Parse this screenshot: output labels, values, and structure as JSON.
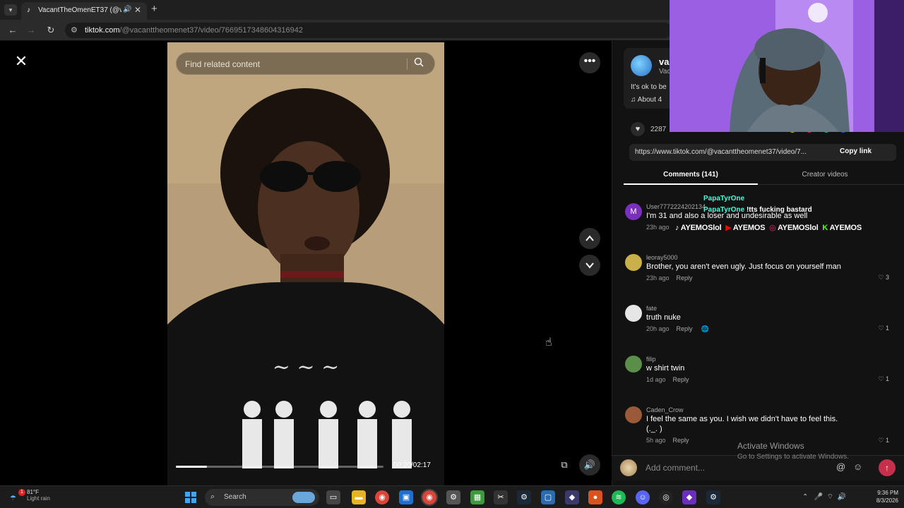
{
  "browser": {
    "tab_title": "VacantTheOmenET37 (@va",
    "url_host": "tiktok.com",
    "url_path": "/@vacanttheomenet37/video/7669517348604316942"
  },
  "video": {
    "search_placeholder": "Find related content",
    "time_readout": "00:20/02:17",
    "progress_fraction": 0.15
  },
  "author": {
    "name": "va",
    "handle": "Vac",
    "caption": "It's ok to be",
    "music": "♫  About 4"
  },
  "stats": {
    "likes": "2287"
  },
  "share": {
    "link": "https://www.tiktok.com/@vacanttheomenet37/video/7...",
    "copy_label": "Copy link"
  },
  "tabs": {
    "comments": "Comments (141)",
    "creator_videos": "Creator videos"
  },
  "comments": [
    {
      "user": "User7772224202134",
      "text": "I'm 31 and also a loser and undesirable as well",
      "time": "23h ago",
      "reply": "Reply",
      "likes": "",
      "avatar_letter": "M",
      "avatar_color": "#7b2fbf"
    },
    {
      "user": "leoray5000",
      "text": "Brother, you aren't even ugly. Just focus on yourself man",
      "time": "23h ago",
      "reply": "Reply",
      "likes": "3",
      "avatar_letter": "",
      "avatar_color": "#c9b04a"
    },
    {
      "user": "fate",
      "text": "truth nuke",
      "time": "20h ago",
      "reply": "Reply",
      "likes": "1",
      "avatar_letter": "",
      "avatar_color": "#e6e6e6"
    },
    {
      "user": "filip",
      "text": "w shirt twin",
      "time": "1d ago",
      "reply": "Reply",
      "likes": "1",
      "avatar_letter": "",
      "avatar_color": "#5a8f4a"
    },
    {
      "user": "Caden_Crow",
      "text": "I feel the same as you. I wish we didn't have to feel this.",
      "text2": "(._. )",
      "time": "5h ago",
      "reply": "Reply",
      "likes": "1",
      "avatar_letter": "",
      "avatar_color": "#9a5a3a"
    }
  ],
  "stream_overlay": {
    "line1": "PapaTyrOne",
    "line2_name": "PapaTyrOne",
    "line2_msg": "!tts fucking bastard",
    "socials": [
      "AYEMOSlol",
      "AYEMOS",
      "AYEMOSlol",
      "AYEMOS"
    ]
  },
  "add_comment": {
    "placeholder": "Add comment...",
    "at": "@",
    "emoji": "☺"
  },
  "activation": {
    "title": "Activate Windows",
    "subtitle": "Go to Settings to activate Windows."
  },
  "taskbar": {
    "weather_temp": "81°F",
    "weather_desc": "Light rain",
    "weather_badge": "1",
    "search_label": "Search",
    "time": "9:36 PM",
    "date": "8/3/2026"
  },
  "colors": {
    "accent": "#c7304a",
    "panel_bg": "#121212",
    "chrome_bg": "#2b2b2b"
  }
}
